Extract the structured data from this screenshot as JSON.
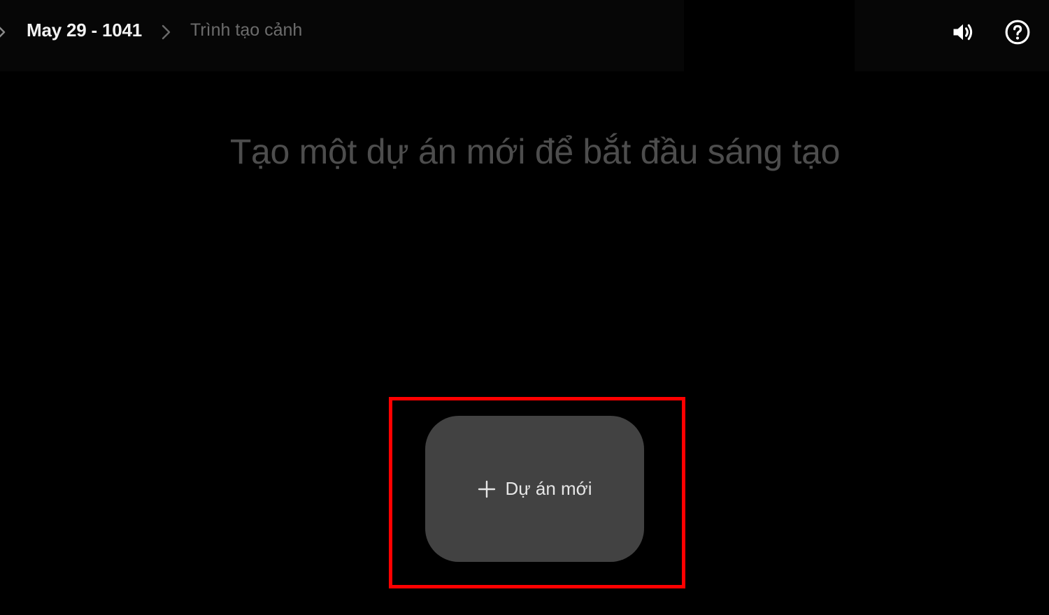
{
  "breadcrumb": {
    "project": "May 29 - 1041",
    "current": "Trình tạo cảnh"
  },
  "toolbar": {
    "sound_icon": "volume-icon",
    "help_icon": "help-circle-icon"
  },
  "main": {
    "headline": "Tạo một dự án mới để bắt đầu sáng tạo",
    "new_project_label": "Dự án mới",
    "new_project_icon": "plus-icon"
  },
  "colors": {
    "background": "#000000",
    "button_bg": "#424242",
    "highlight": "#ff0000",
    "muted_text": "#4d4d4d"
  }
}
